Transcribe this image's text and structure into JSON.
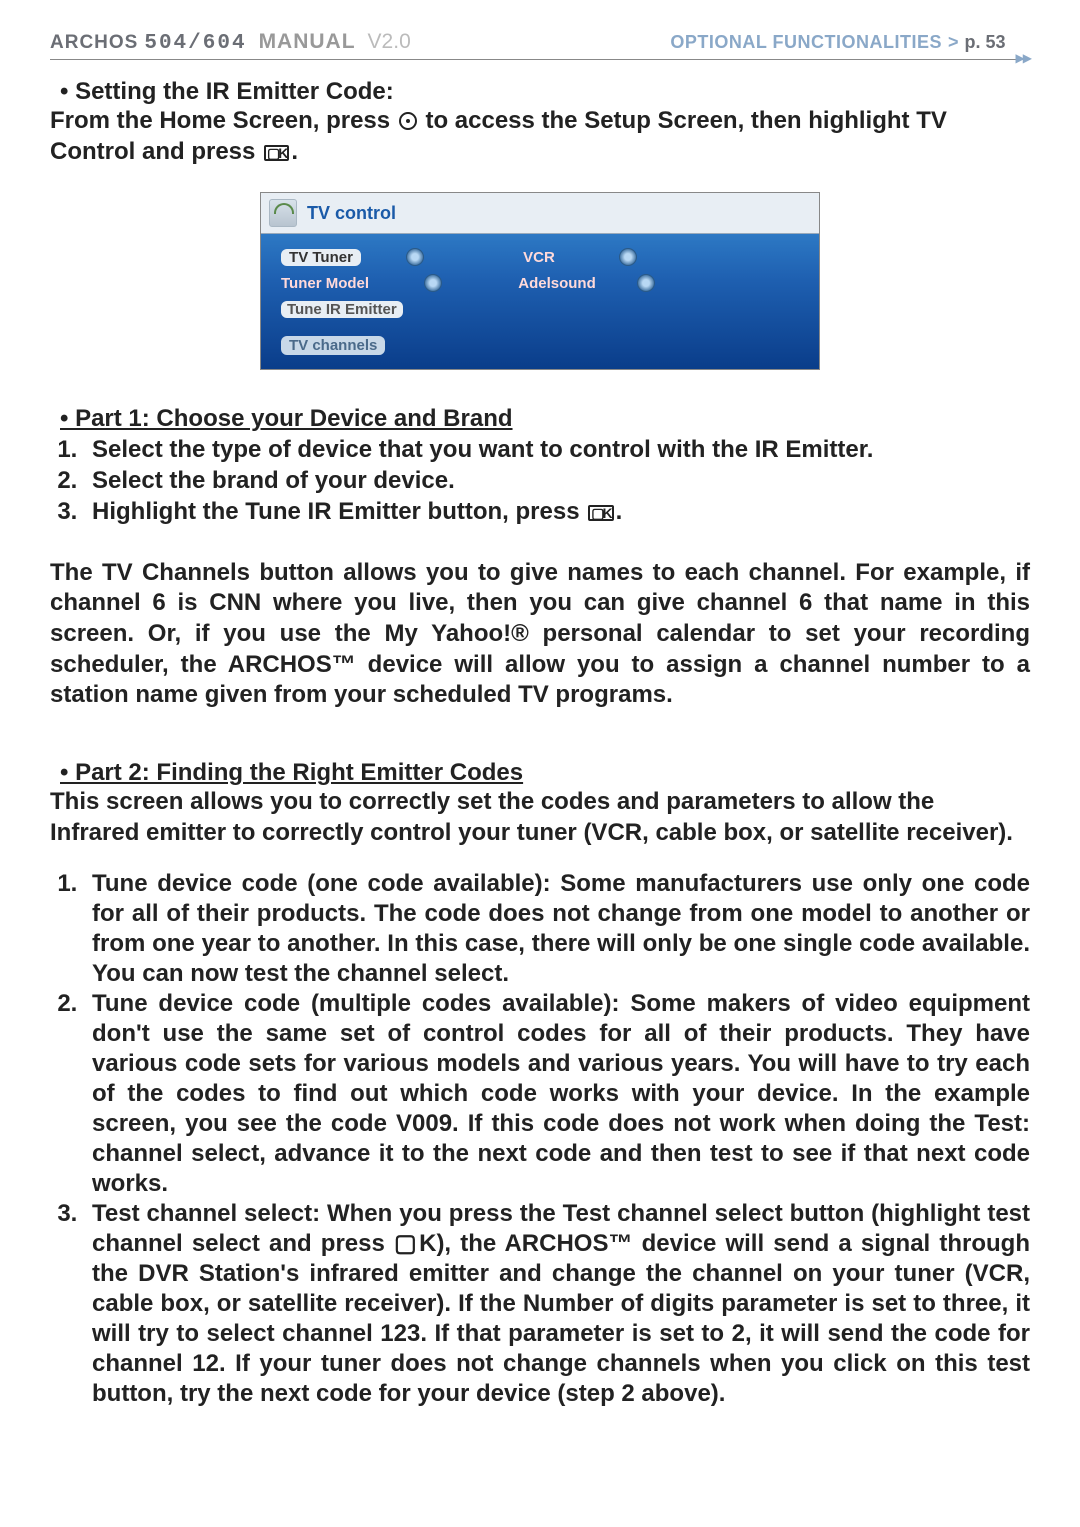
{
  "header": {
    "brand": "ARCHOS",
    "model": "504/604",
    "manual": "MANUAL",
    "version": "V2.0",
    "section": "OPTIONAL FUNCTIONALITIES",
    "page": "p. 53"
  },
  "section1": {
    "heading": "• Setting the IR Emitter Code:",
    "intro_pre": "From the Home Screen, press ",
    "intro_mid": " to access the Setup Screen, then highlight TV Control and press ",
    "intro_end": "."
  },
  "tv_control": {
    "title": "TV control",
    "rows": [
      {
        "label": "TV Tuner",
        "value": "VCR",
        "selected": true
      },
      {
        "label": "Tuner Model",
        "value": "Adelsound",
        "selected": false
      }
    ],
    "tune_button": "Tune IR Emitter",
    "channels_button": "TV channels"
  },
  "part1": {
    "heading": "• Part 1: Choose your Device and Brand",
    "steps": [
      "Select the type of device that you want to control with the IR Emitter.",
      "Select the brand of your device.",
      "Highlight the Tune IR Emitter button, press "
    ]
  },
  "tv_channels_para": "The TV Channels button allows you to give names to each channel. For example, if channel 6 is CNN where you live, then you can give channel 6 that name in this screen. Or, if you use the My Yahoo!® personal calendar to set your recording scheduler, the ARCHOS™ device will allow you to assign a channel number to a station name given from your scheduled TV programs.",
  "part2": {
    "heading": "• Part 2: Finding the Right Emitter Codes",
    "intro": "This screen allows you to correctly set the codes and parameters to allow the Infrared emitter to correctly control your tuner (VCR, cable box, or satellite receiver).",
    "steps": [
      "Tune device code (one code available): Some manufacturers use only one code for all of their products. The code does not change from one model to another or from one year to another. In this case, there will only be one single code available. You can now test the channel select.",
      "Tune device code (multiple codes available): Some makers of video equipment don't use the same set of control codes for all of their products. They have various code sets for various models and various years. You will have to try each of the codes to find out which code works with your device. In the example screen, you see the code V009. If this code does not work when doing the Test: channel select, advance it to the next code and then test to see if that next code works.",
      "Test channel select: When you press the Test channel select button (highlight test channel select and press ▢K), the ARCHOS™ device will send a signal through the DVR Station's infrared emitter and change the channel on your tuner (VCR, cable box, or satellite receiver). If the Number of digits parameter is set to three, it will try to select channel 123. If that parameter is set to 2, it will send the code for channel 12. If your tuner does not change channels when you click on this test button, try the next code for your device (step 2 above)."
    ]
  }
}
